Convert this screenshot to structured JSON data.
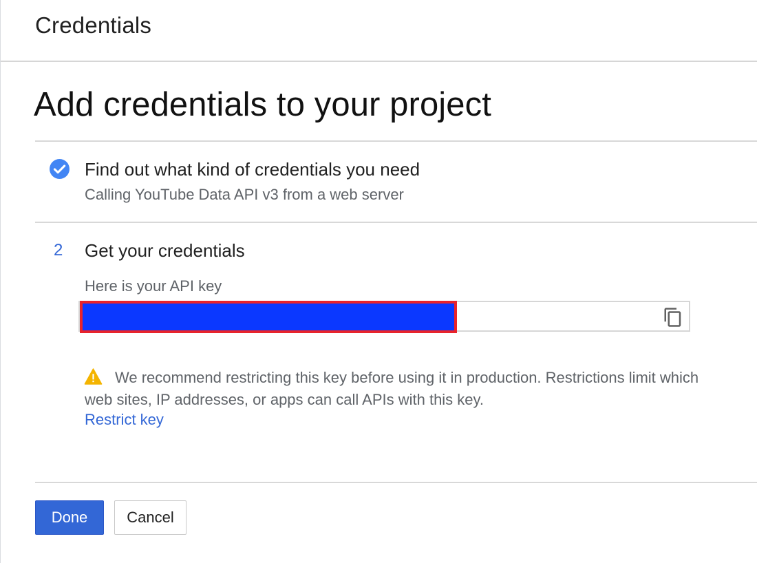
{
  "header": {
    "title": "Credentials"
  },
  "main": {
    "heading": "Add credentials to your project",
    "steps": [
      {
        "marker": "check-icon",
        "title": "Find out what kind of credentials you need",
        "subtitle": "Calling YouTube Data API v3 from a web server",
        "status": "complete"
      },
      {
        "marker": "2",
        "title": "Get your credentials",
        "api_key_label": "Here is your API key",
        "api_key_value": "",
        "copy_icon": "copy-icon"
      }
    ],
    "warning": {
      "icon": "warning-icon",
      "text": "We recommend restricting this key before using it in production. Restrictions limit which web sites, IP addresses, or apps can call APIs with this key.",
      "link_label": "Restrict key"
    }
  },
  "footer": {
    "done_label": "Done",
    "cancel_label": "Cancel"
  },
  "colors": {
    "accent": "#3367d6",
    "check": "#4285f4",
    "warning": "#f4b400",
    "redaction_fill": "#0b38ff",
    "redaction_border": "#e8232b"
  }
}
